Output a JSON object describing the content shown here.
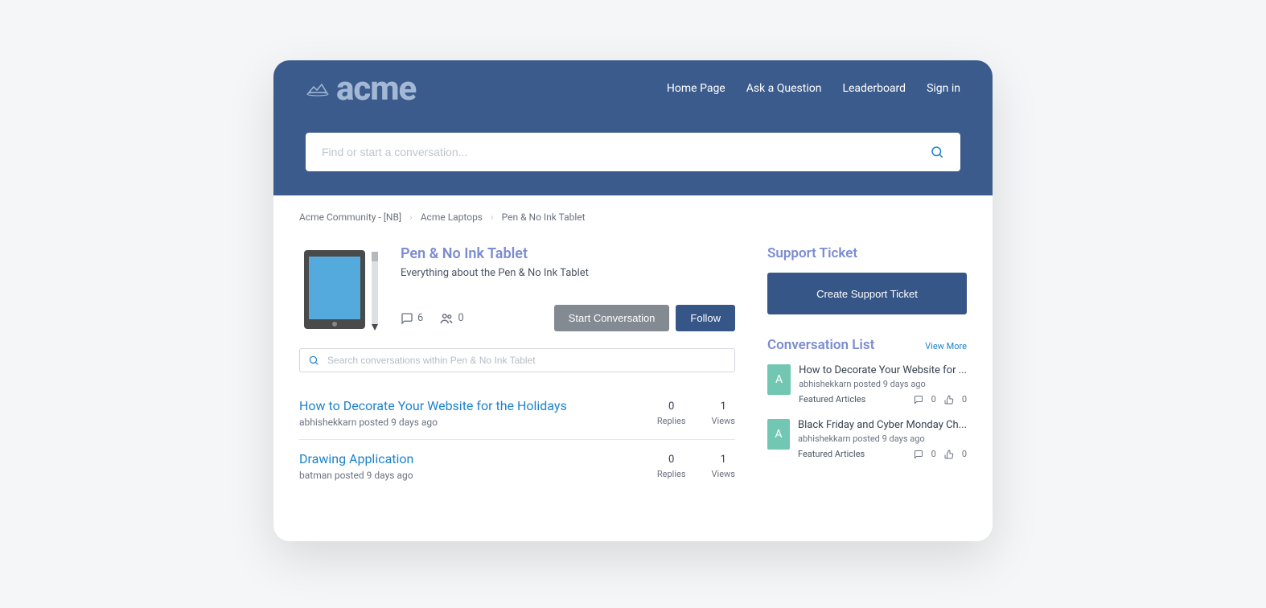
{
  "brand": "acme",
  "nav": {
    "home": "Home Page",
    "ask": "Ask a Question",
    "leaderboard": "Leaderboard",
    "signin": "Sign in"
  },
  "search": {
    "placeholder": "Find or start a conversation..."
  },
  "breadcrumb": {
    "root": "Acme Community - [NB]",
    "parent": "Acme Laptops",
    "current": "Pen & No Ink Tablet"
  },
  "topic": {
    "title": "Pen & No Ink Tablet",
    "description": "Everything about the Pen & No Ink Tablet",
    "comments": "6",
    "followers": "0",
    "start_btn": "Start Conversation",
    "follow_btn": "Follow",
    "search_placeholder": "Search conversations within Pen & No Ink Tablet"
  },
  "conversations": [
    {
      "title": "How to Decorate Your Website for the Holidays",
      "meta": "abhishekkarn posted 9 days ago",
      "replies": "0",
      "replies_label": "Replies",
      "views": "1",
      "views_label": "Views"
    },
    {
      "title": "Drawing Application",
      "meta": "batman posted 9 days ago",
      "replies": "0",
      "replies_label": "Replies",
      "views": "1",
      "views_label": "Views"
    }
  ],
  "sidebar": {
    "support_heading": "Support Ticket",
    "create_ticket": "Create Support Ticket",
    "convo_heading": "Conversation List",
    "view_more": "View More",
    "items": [
      {
        "avatar": "A",
        "title": "How to Decorate Your Website for ...",
        "meta": "abhishekkarn posted 9 days ago",
        "category": "Featured Articles",
        "comments": "0",
        "likes": "0"
      },
      {
        "avatar": "A",
        "title": "Black Friday and Cyber Monday Ch...",
        "meta": "abhishekkarn posted 9 days ago",
        "category": "Featured Articles",
        "comments": "0",
        "likes": "0"
      }
    ]
  }
}
